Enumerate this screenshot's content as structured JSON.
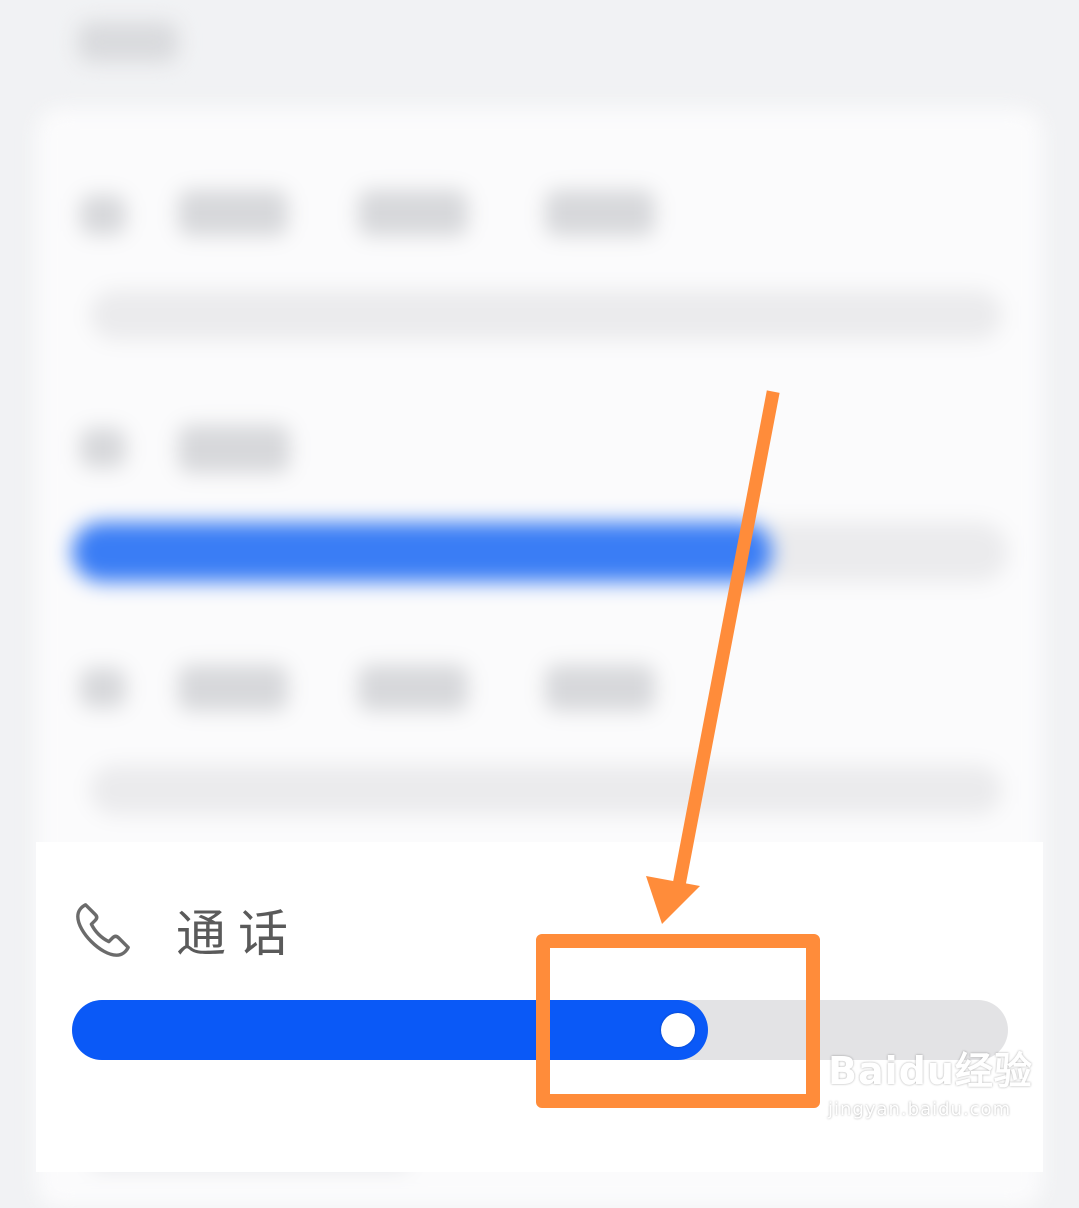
{
  "call_volume": {
    "label": "通话",
    "icon": "phone-icon",
    "level_fraction": 0.68
  },
  "colors": {
    "accent": "#0a59f7",
    "track": "#e3e3e5",
    "annotation": "#ff8c3a"
  },
  "watermark": {
    "logo": "Baidu经验",
    "url": "jingyan.baidu.com"
  }
}
